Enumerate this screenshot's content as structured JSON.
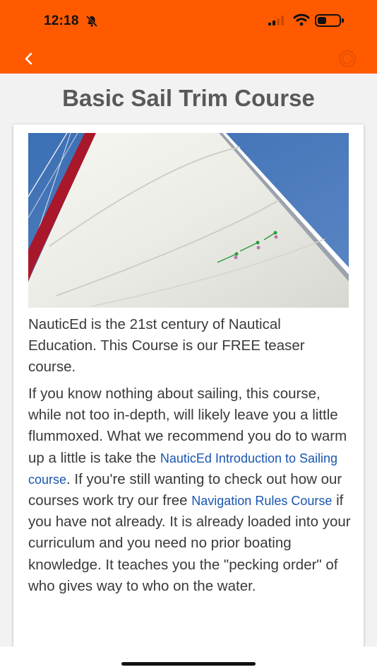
{
  "status_bar": {
    "time": "12:18"
  },
  "nav": {
    "back": "back",
    "menu": "ring"
  },
  "page": {
    "title": "Basic Sail Trim Course"
  },
  "hero_image": {
    "description_icon": "sail-photo"
  },
  "body": {
    "p1": "NauticEd is the 21st century of Nautical Education. This Course is our FREE teaser course.",
    "p2_before_link1": "If you know nothing about sailing,  this course, while not too in-depth, will likely leave you a little flummoxed. What we recommend you do to warm up a little is take the ",
    "link1": "NauticEd Introduction to Sailing course",
    "p2_between": ". If you're still wanting to check out how our courses work try our free ",
    "link2": "Navigation Rules Course",
    "p2_after": " if you have not already. It is already loaded into your curriculum and you need no prior boating knowledge. It teaches you the \"pecking order\" of who gives way to who on the water."
  },
  "colors": {
    "header": "#ff5a00",
    "link": "#1a55b0",
    "text": "#3a3a3a"
  }
}
